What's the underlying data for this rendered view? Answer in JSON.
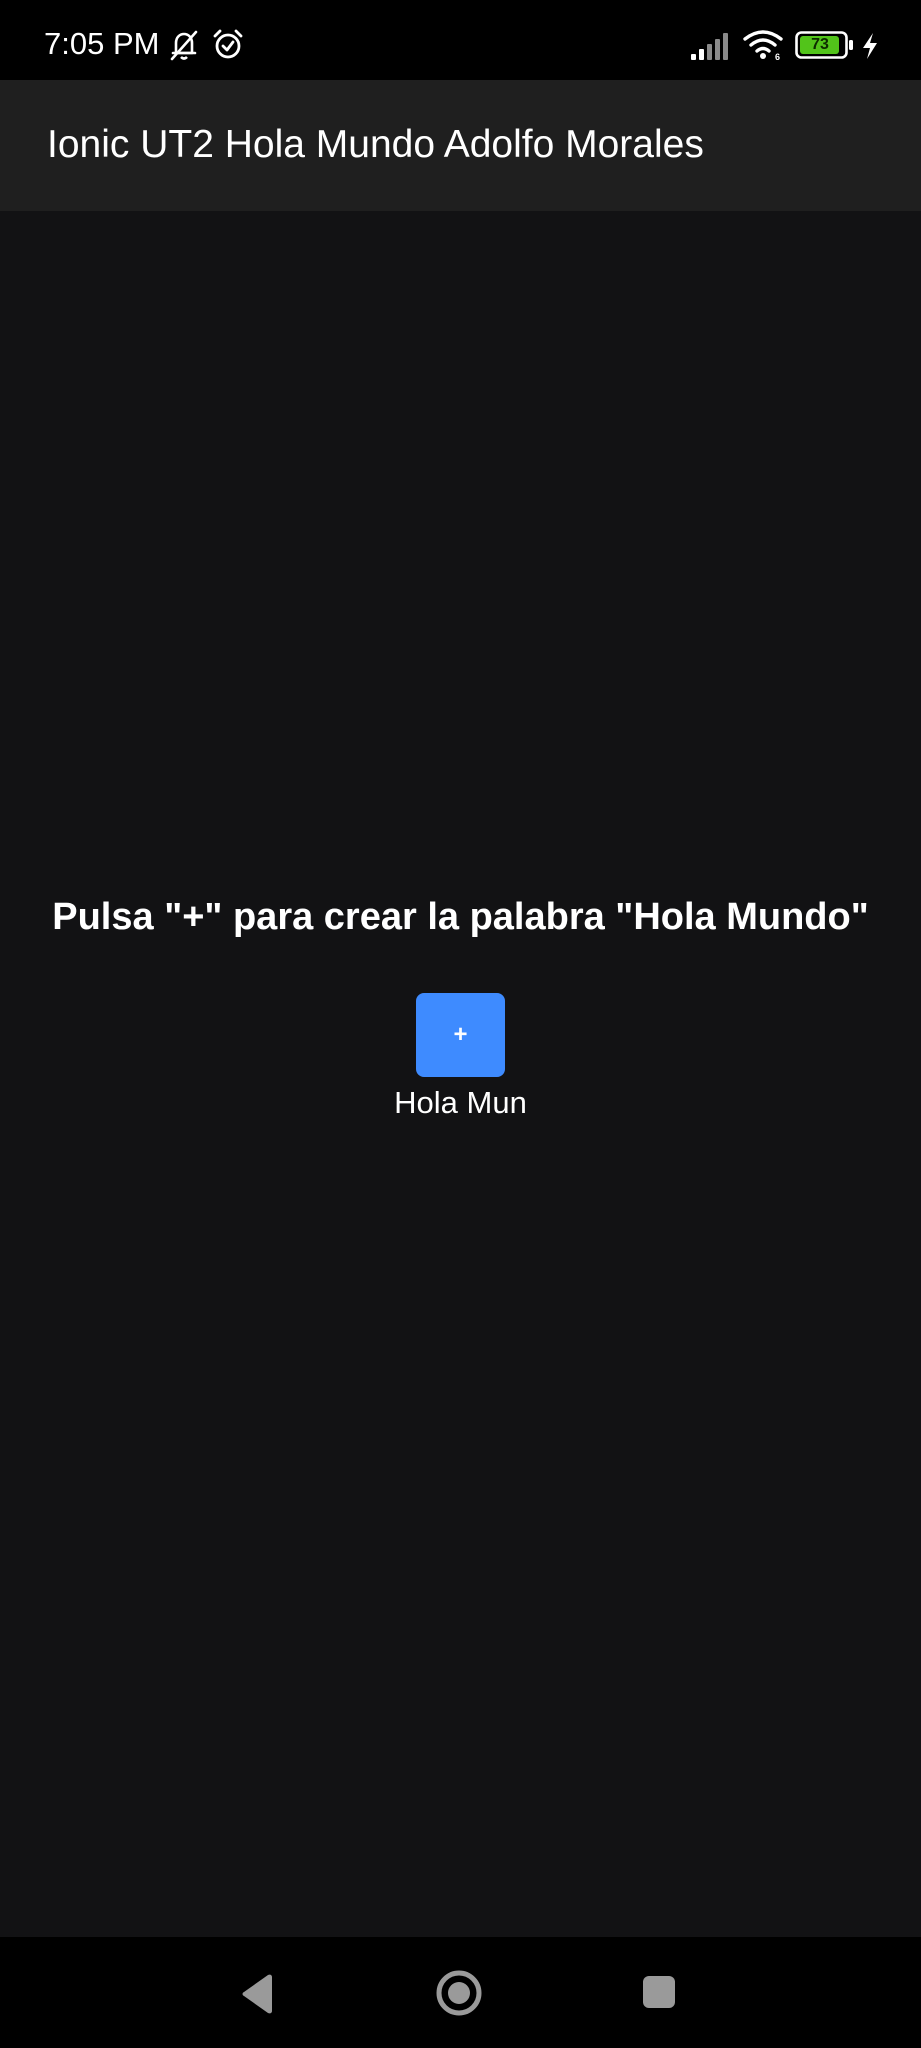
{
  "status_bar": {
    "time": "7:05 PM",
    "battery_level": "73",
    "icons": [
      "bell-off-icon",
      "alarm-icon",
      "signal-icon",
      "wifi-icon",
      "battery-icon",
      "charging-icon"
    ]
  },
  "toolbar": {
    "title": "Ionic UT2 Hola Mundo Adolfo Morales"
  },
  "main": {
    "prompt": "Pulsa \"+\" para crear la palabra \"Hola Mundo\"",
    "add_button_label": "+",
    "result_text": "Hola Mun"
  },
  "nav_bar": {
    "icons": [
      "back-icon",
      "home-icon",
      "recents-icon"
    ]
  },
  "colors": {
    "background": "#121214",
    "toolbar": "#1f1f1f",
    "button": "#3e8bff",
    "battery_fill": "#52c41a"
  }
}
